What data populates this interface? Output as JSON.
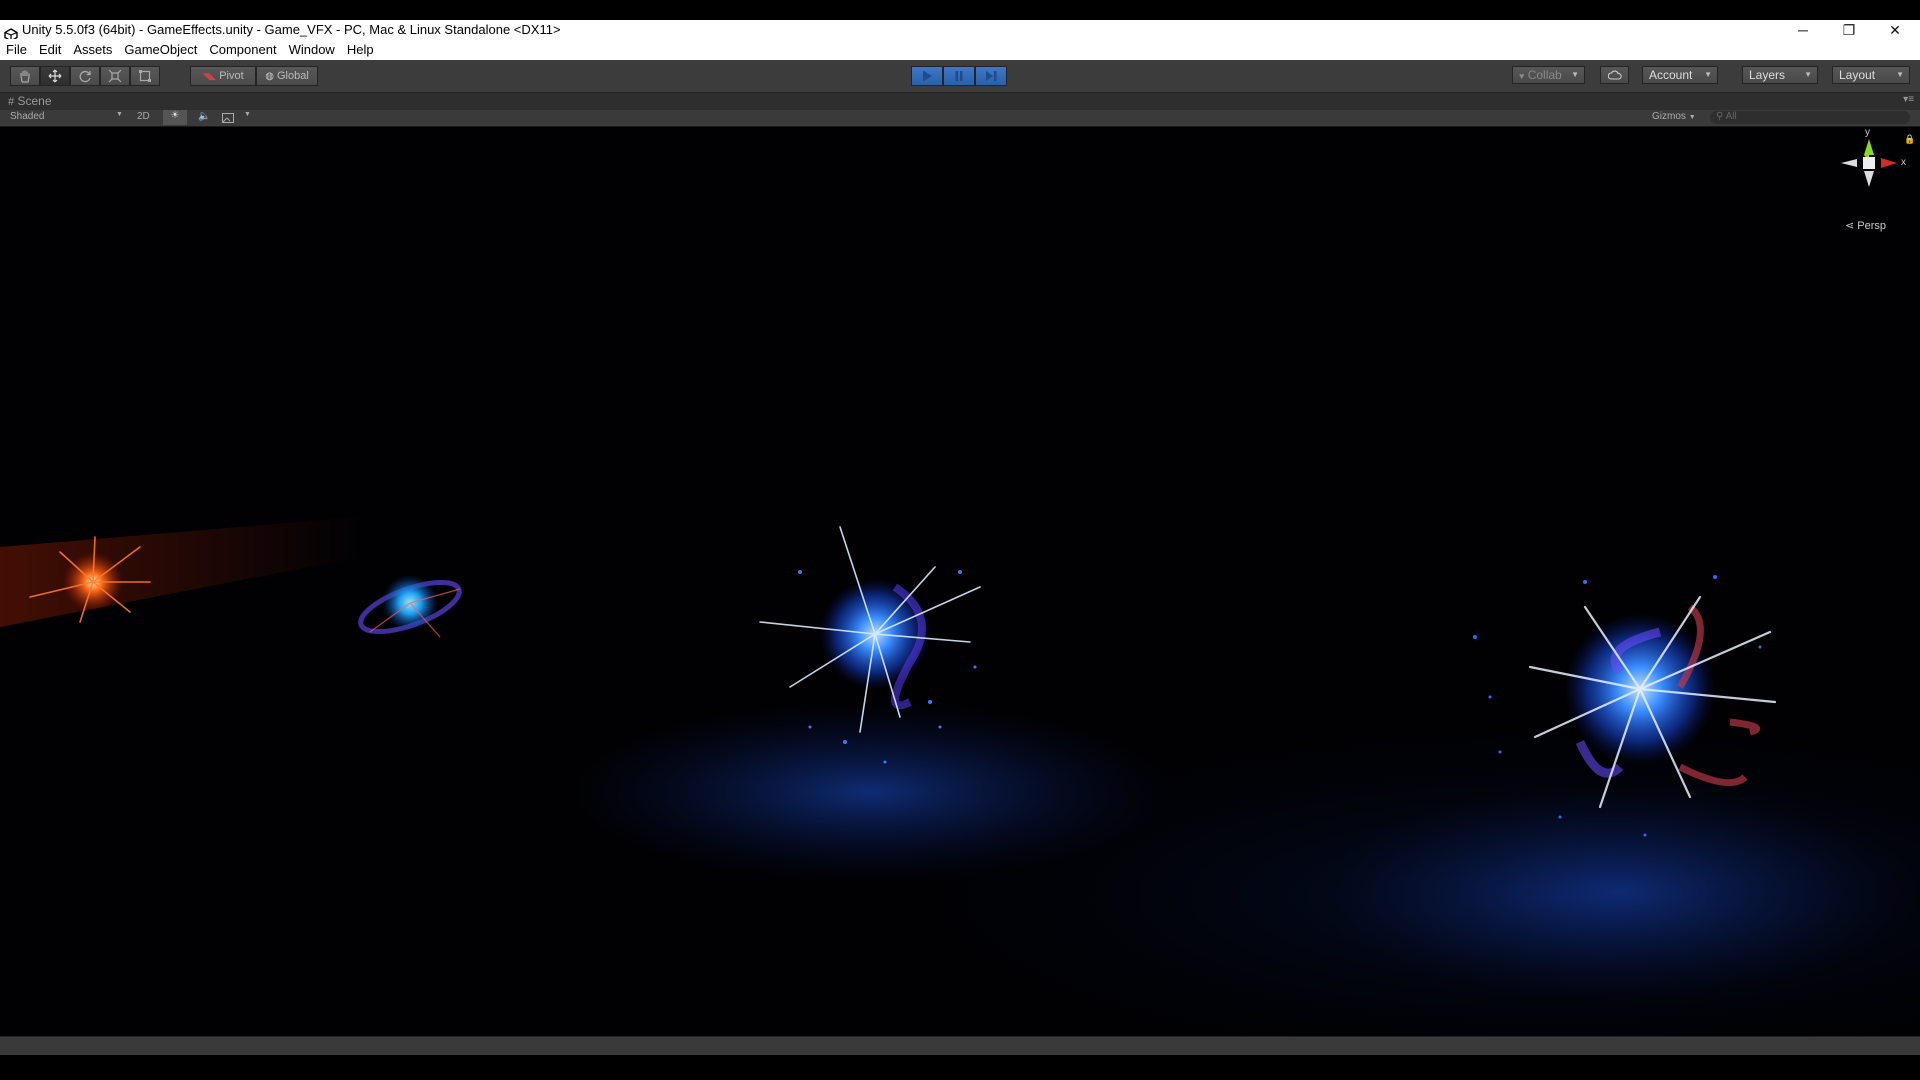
{
  "window": {
    "title": "Unity 5.5.0f3 (64bit) - GameEffects.unity - Game_VFX - PC, Mac & Linux Standalone <DX11>",
    "minimize_glyph": "─",
    "restore_glyph": "❐",
    "close_glyph": "✕"
  },
  "menu": [
    "File",
    "Edit",
    "Assets",
    "GameObject",
    "Component",
    "Window",
    "Help"
  ],
  "toolbar": {
    "pivot_label": "Pivot",
    "global_label": "Global",
    "collab_label": "Collab",
    "account_label": "Account",
    "layers_label": "Layers",
    "layout_label": "Layout"
  },
  "scene": {
    "tab_label": "Scene",
    "shading_mode": "Shaded",
    "mode_2d": "2D",
    "gizmos_label": "Gizmos",
    "search_placeholder": "All",
    "gizmo_y": "y",
    "gizmo_x": "x",
    "projection_label": "Persp"
  },
  "colors": {
    "play_active": "#3d79c9",
    "effect_blue": "#2f7bff",
    "effect_orange": "#ff5a1c"
  },
  "icons": {
    "tools": [
      "hand-icon",
      "move-icon",
      "rotate-icon",
      "scale-icon",
      "rect-icon"
    ],
    "playback": [
      "play-icon",
      "pause-icon",
      "step-icon"
    ]
  }
}
